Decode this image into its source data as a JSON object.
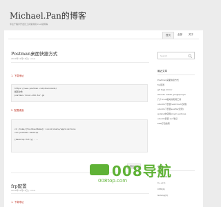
{
  "site": {
    "title": "Michael.Pan的博客",
    "description": "专注于程序开发及工具使用和linux使用等"
  },
  "nav": [
    {
      "label": "首页"
    },
    {
      "label": "全部"
    },
    {
      "label": "关于"
    }
  ],
  "posts": [
    {
      "title": "Postman桌面快捷方式",
      "meta": "2019年12月13日 | Linux",
      "sections": [
        {
          "heading": "1. 下载地址",
          "code": [
            "https://www.postman.com/downloads/",
            "解压文件",
            "postman-linux-x64.tar.gz"
          ]
        },
        {
          "heading": "2. 配置桌面",
          "code": [
            "cd /home/[YourUserName]/.local/share/applications",
            "vim postman.desktop",
            "",
            "[Desktop Entry] ..."
          ]
        }
      ],
      "read_more": "阅读全文"
    },
    {
      "title": "frp配置",
      "meta": "2019年12月13日 | Linux",
      "sections": [
        {
          "heading": "1. 下载地址"
        }
      ]
    }
  ],
  "sidebar": {
    "search_placeholder": "Search",
    "recent_title": "最近文章",
    "recent_posts": [
      "Postman桌面快捷方式",
      "frp配置",
      "git tags mirror",
      "Ubuntu install googlepinyin",
      "几个linux相关的实用工具",
      "ubuntu下安装nextcloud(仅限)",
      "ubuntu下安装seafile(仅限)",
      "golang中使用pinyin-verbose",
      "ubuntu安装 ssr 笔记",
      "K8S打包指南"
    ],
    "categories_title": "分类",
    "categories": [
      "Android(1)",
      "C++(1)",
      "CMS(1)",
      "Golang(5)"
    ]
  },
  "watermark": {
    "text": "008导航",
    "url": "008top.com"
  },
  "colors": {
    "accent_red": "#c0392b",
    "watermark_green": "#5fb236"
  }
}
